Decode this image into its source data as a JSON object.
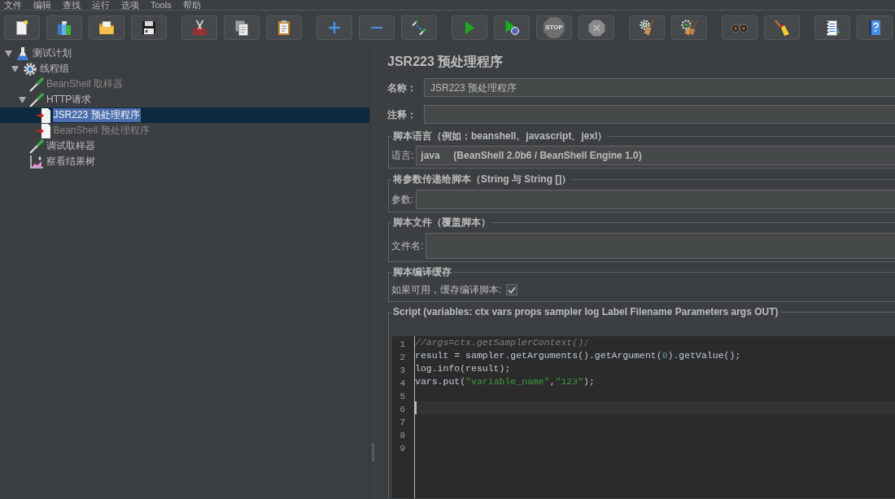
{
  "menu": [
    "文件",
    "编辑",
    "查找",
    "运行",
    "选项",
    "Tools",
    "帮助"
  ],
  "toolbar": {
    "groups": [
      {
        "buttons": [
          {
            "kind": "new",
            "disabled": false
          },
          {
            "kind": "templates",
            "disabled": false
          },
          {
            "kind": "open",
            "disabled": false
          },
          {
            "kind": "save",
            "disabled": false
          }
        ]
      },
      {
        "buttons": [
          {
            "kind": "cut",
            "disabled": false
          },
          {
            "kind": "copy",
            "disabled": false
          },
          {
            "kind": "paste",
            "disabled": false
          }
        ]
      },
      {
        "buttons": [
          {
            "kind": "expand",
            "disabled": false
          },
          {
            "kind": "collapse",
            "disabled": false
          },
          {
            "kind": "toggle",
            "disabled": false
          }
        ]
      },
      {
        "buttons": [
          {
            "kind": "start",
            "disabled": false
          },
          {
            "kind": "start_no_pauses",
            "disabled": false
          },
          {
            "kind": "stop",
            "disabled": true,
            "label": "STOP"
          },
          {
            "kind": "shutdown",
            "disabled": true
          }
        ]
      },
      {
        "buttons": [
          {
            "kind": "clear",
            "disabled": false
          },
          {
            "kind": "clear_all",
            "disabled": false
          }
        ]
      },
      {
        "buttons": [
          {
            "kind": "search",
            "disabled": false
          },
          {
            "kind": "reset_search",
            "disabled": false
          }
        ]
      },
      {
        "buttons": [
          {
            "kind": "function_helper",
            "disabled": false
          },
          {
            "kind": "help",
            "disabled": false
          }
        ]
      }
    ]
  },
  "tree": [
    {
      "kind": "test_plan",
      "label": "测试计划",
      "expanded": true,
      "selected": false,
      "disabled": false,
      "children": [
        {
          "kind": "thread_group",
          "label": "线程组",
          "expanded": true,
          "selected": false,
          "disabled": false,
          "children": [
            {
              "kind": "sampler",
              "label": "BeanShell 取样器",
              "selected": false,
              "disabled": true
            },
            {
              "kind": "sampler",
              "label": "HTTP请求",
              "expanded": true,
              "selected": false,
              "disabled": false,
              "children": [
                {
                  "kind": "preprocessor",
                  "label": "JSR223 预处理程序",
                  "selected": true,
                  "disabled": false
                },
                {
                  "kind": "preprocessor",
                  "label": "BeanShell 预处理程序",
                  "selected": false,
                  "disabled": true
                }
              ]
            },
            {
              "kind": "sampler",
              "label": "调试取样器",
              "selected": false,
              "disabled": false
            },
            {
              "kind": "listener",
              "label": "察看结果树",
              "selected": false,
              "disabled": false
            }
          ]
        }
      ]
    }
  ],
  "editor": {
    "title": "JSR223 预处理程序",
    "fields": [
      {
        "label": "名称：",
        "value": "JSR223 预处理程序"
      },
      {
        "label": "注释："
      }
    ],
    "sections": [
      {
        "kind": "select",
        "legend": "脚本语言（例如：beanshell、javascript、jexl）",
        "label": "语言:",
        "value": "java     (BeanShell 2.0b6 / BeanShell Engine 1.0)"
      },
      {
        "kind": "text",
        "legend": "将参数传递给脚本（String 与 String []）",
        "label": "参数:"
      },
      {
        "kind": "file",
        "legend": "脚本文件（覆盖脚本）",
        "label": "文件名:"
      },
      {
        "kind": "checkbox",
        "legend": "脚本编译缓存",
        "label": "如果可用，缓存编译脚本:",
        "checked": true
      },
      {
        "kind": "script",
        "legend": "Script (variables: ctx vars props sampler log Label Filename Parameters args OUT)",
        "lines": [
          {
            "number": "1",
            "current": false,
            "tokens": [
              {
                "kind": "comment",
                "text": "//args=ctx.getSamplerContext();"
              }
            ]
          },
          {
            "number": "2",
            "current": false,
            "tokens": [
              {
                "kind": "plain",
                "text": "result = sampler.getArguments().getArgument("
              },
              {
                "kind": "number",
                "text": "0"
              },
              {
                "kind": "plain",
                "text": ").getValue();"
              }
            ]
          },
          {
            "number": "3",
            "current": false,
            "tokens": [
              {
                "kind": "plain",
                "text": "log.info(result);"
              }
            ]
          },
          {
            "number": "4",
            "current": false,
            "tokens": [
              {
                "kind": "plain",
                "text": "vars.put("
              },
              {
                "kind": "string",
                "text": "\"variable_name\""
              },
              {
                "kind": "plain",
                "text": ","
              },
              {
                "kind": "string",
                "text": "\"123\""
              },
              {
                "kind": "plain",
                "text": ");"
              }
            ]
          },
          {
            "number": "5",
            "current": false
          },
          {
            "number": "6",
            "current": true
          },
          {
            "number": "7",
            "current": false
          },
          {
            "number": "8",
            "current": false
          },
          {
            "number": "9",
            "current": false
          }
        ]
      }
    ]
  }
}
